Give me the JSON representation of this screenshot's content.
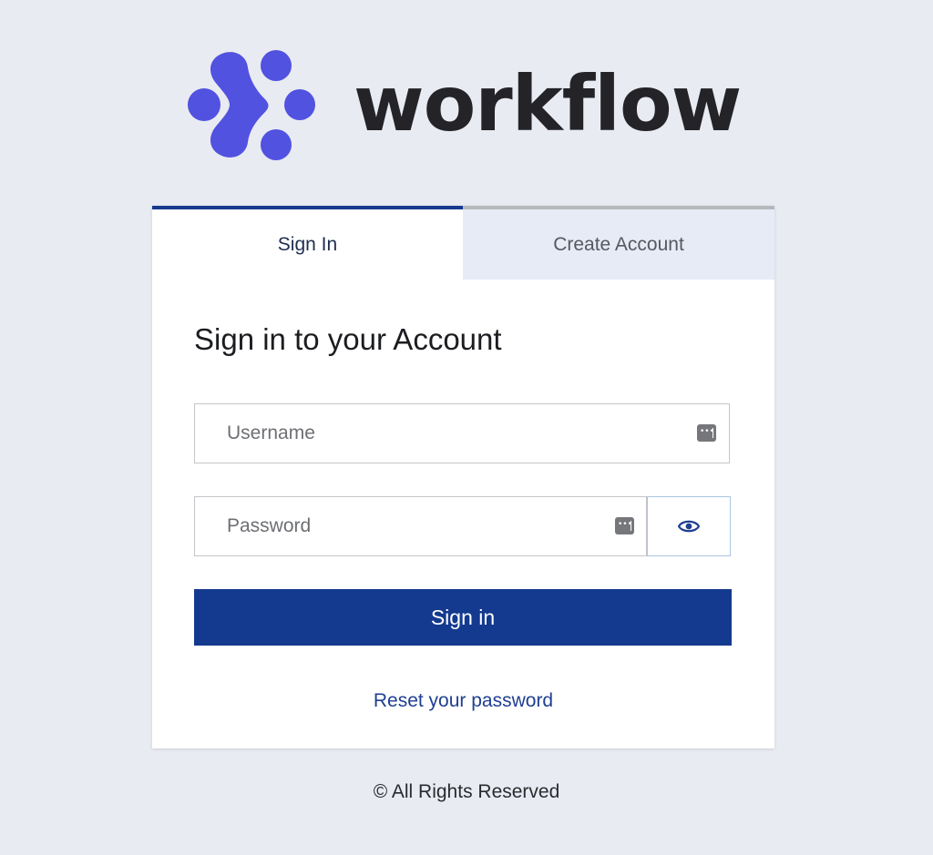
{
  "brand": {
    "name": "workflow",
    "logo_icon": "workflow-dots-logo-icon",
    "logo_color": "#5152e0"
  },
  "tabs": {
    "signin_label": "Sign In",
    "create_label": "Create Account",
    "active": "Sign In"
  },
  "form": {
    "heading": "Sign in to your Account",
    "username_placeholder": "Username",
    "username_value": "",
    "password_placeholder": "Password",
    "password_value": "",
    "password_icon": "eye-icon",
    "field_icon": "password-manager-icon",
    "submit_label": "Sign in",
    "reset_label": "Reset your password"
  },
  "footer": {
    "text": "© All Rights Reserved"
  },
  "colors": {
    "primary": "#143a8f",
    "background": "#e8ebf1",
    "inactive_tab": "#e6ebf6"
  }
}
